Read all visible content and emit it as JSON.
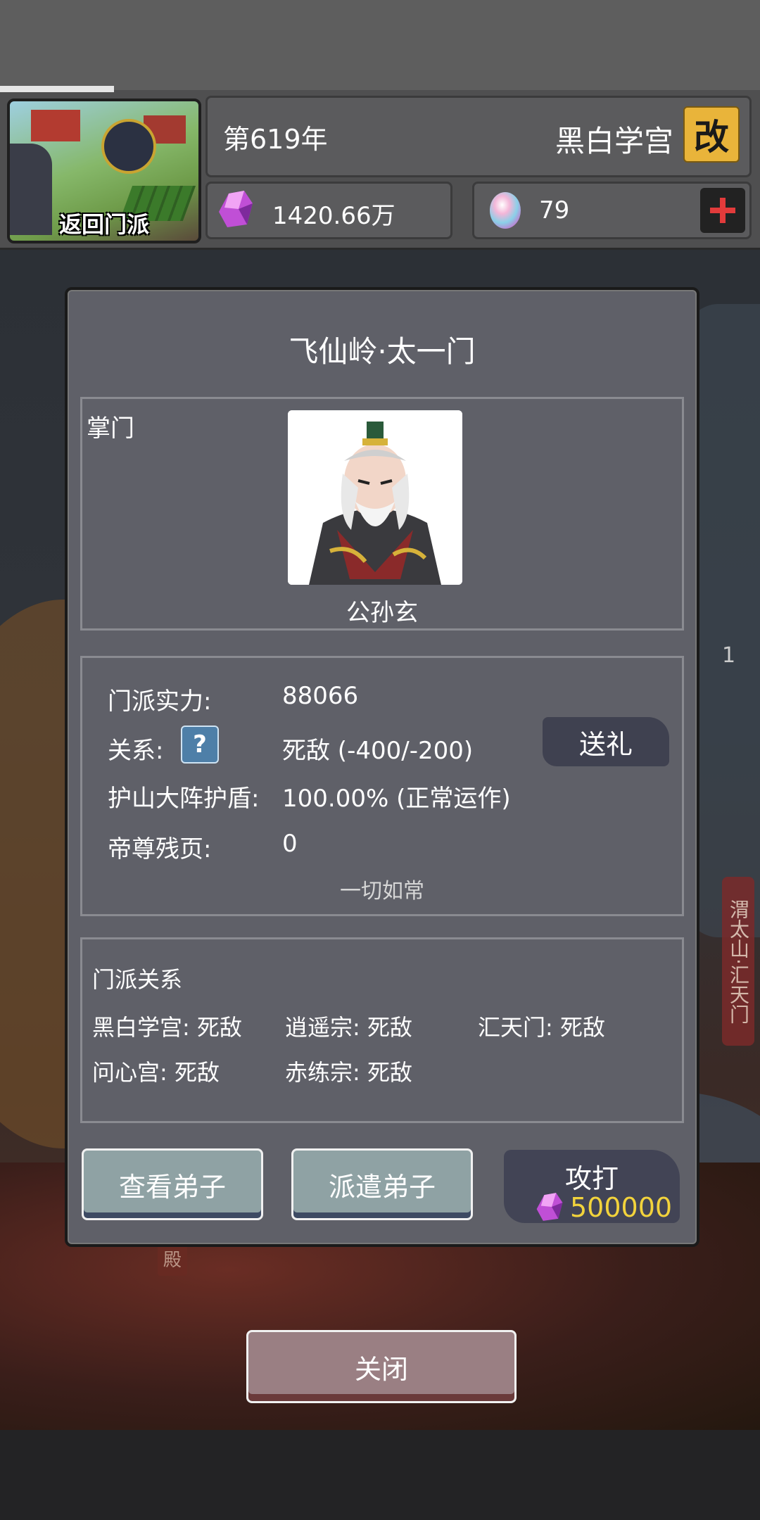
{
  "header": {
    "return_label": "返回门派",
    "year": "第619年",
    "sect_name": "黑白学宫",
    "rename_label": "改",
    "spirit_stones": "1420.66万",
    "gems": "79"
  },
  "modal": {
    "title": "飞仙岭·太一门",
    "leader": {
      "label": "掌门",
      "name": "公孙玄"
    },
    "stats": {
      "power_label": "门派实力:",
      "power_value": "88066",
      "relation_label": "关系:",
      "relation_value": "死敌  (-400/-200)",
      "shield_label": "护山大阵护盾:",
      "shield_value": "100.00% (正常运作)",
      "pages_label": "帝尊残页:",
      "pages_value": "0",
      "note": "一切如常",
      "gift_label": "送礼"
    },
    "relations": {
      "title": "门派关系",
      "items": [
        "黑白学宫: 死敌",
        "逍遥宗: 死敌",
        "汇天门: 死敌",
        "问心宫: 死敌",
        "赤练宗: 死敌"
      ]
    },
    "buttons": {
      "view_disciples": "查看弟子",
      "dispatch_disciples": "派遣弟子",
      "attack": "攻打",
      "attack_cost": "500000"
    }
  },
  "close_label": "关闭",
  "side": {
    "sect_tag": "渭太山·汇天门",
    "count": "1",
    "hall": "殿"
  },
  "colors": {
    "rename_bg": "#e9b43a",
    "cost_text": "#f2d33c",
    "modal_bg": "#5f6068"
  }
}
